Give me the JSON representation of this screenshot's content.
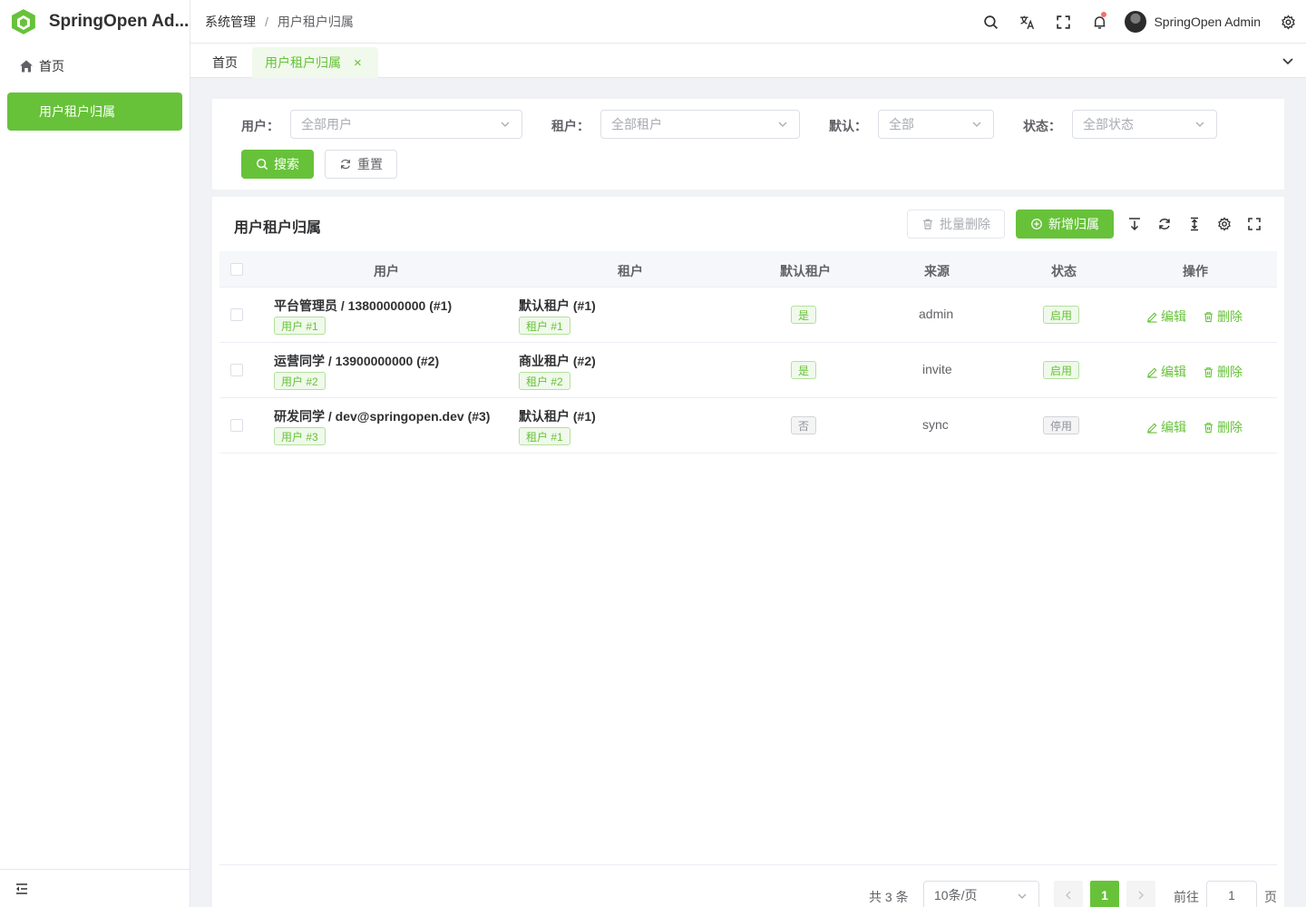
{
  "app": {
    "title": "SpringOpen Ad..."
  },
  "sidebar": {
    "items": [
      {
        "label": "首页",
        "icon": "home-icon"
      },
      {
        "label": "用户租户归属",
        "active": true
      }
    ]
  },
  "header": {
    "breadcrumb": [
      "系统管理",
      "用户租户归属"
    ],
    "user_name": "SpringOpen Admin",
    "icons": [
      "search-icon",
      "translate-icon",
      "fullscreen-icon",
      "bell-icon",
      "settings-icon"
    ]
  },
  "tabs": [
    {
      "label": "首页"
    },
    {
      "label": "用户租户归属",
      "active": true,
      "close": "×"
    }
  ],
  "filters": {
    "user": {
      "label": "用户：",
      "placeholder": "全部用户"
    },
    "tenant": {
      "label": "租户：",
      "placeholder": "全部租户"
    },
    "default": {
      "label": "默认：",
      "placeholder": "全部"
    },
    "status": {
      "label": "状态：",
      "placeholder": "全部状态"
    },
    "search_label": "搜索",
    "reset_label": "重置"
  },
  "table_card": {
    "title": "用户租户归属",
    "batch_delete_label": "批量删除",
    "add_label": "新增归属"
  },
  "table": {
    "columns": [
      "用户",
      "租户",
      "默认租户",
      "来源",
      "状态",
      "操作"
    ],
    "rows": [
      {
        "user": "平台管理员 / 13800000000 (#1)",
        "user_tag": "用户 #1",
        "tenant": "默认租户 (#1)",
        "tenant_tag": "租户 #1",
        "default": "是",
        "source": "admin",
        "status": "启用"
      },
      {
        "user": "运营同学 / 13900000000 (#2)",
        "user_tag": "用户 #2",
        "tenant": "商业租户 (#2)",
        "tenant_tag": "租户 #2",
        "default": "是",
        "source": "invite",
        "status": "启用"
      },
      {
        "user": "研发同学 / dev@springopen.dev (#3)",
        "user_tag": "用户 #3",
        "tenant": "默认租户 (#1)",
        "tenant_tag": "租户 #1",
        "default": "否",
        "source": "sync",
        "status": "停用"
      }
    ],
    "edit_label": "编辑",
    "delete_label": "删除"
  },
  "pagination": {
    "total": "共 3 条",
    "page_size": "10条/页",
    "current_page": "1",
    "goto_label": "前往",
    "goto_value": "1",
    "page_suffix": "页"
  },
  "colors": {
    "primary": "#67c23a",
    "danger_dot": "#f56c6c"
  }
}
